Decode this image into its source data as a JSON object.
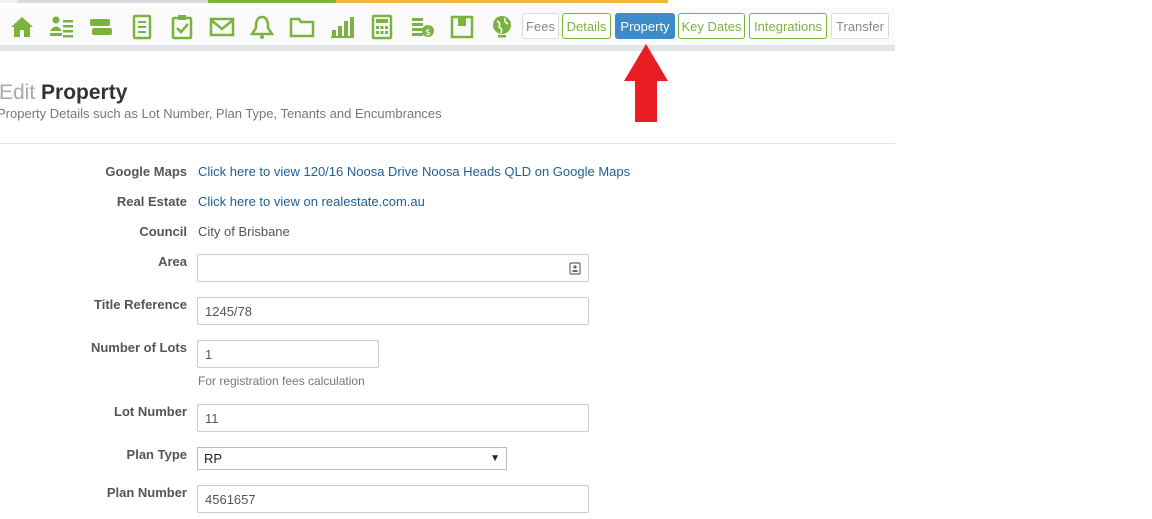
{
  "toolbar": {
    "icons": [
      "home-icon",
      "contacts-list-icon",
      "tag-label-icon",
      "document-icon",
      "checklist-icon",
      "envelope-icon",
      "bell-icon",
      "folder-icon",
      "bar-chart-icon",
      "calculator-icon",
      "money-coins-icon",
      "archive-box-icon",
      "globe-icon"
    ],
    "tabs": {
      "fees": "Fees",
      "details": "Details",
      "property": "Property",
      "key_dates": "Key Dates",
      "integrations": "Integrations",
      "transfer": "Transfer"
    },
    "colors": {
      "icon_green": "#7bb341",
      "active_tab": "#3c8ccc",
      "annotation_arrow": "#ea1c24"
    }
  },
  "header": {
    "title_prefix": "Edit",
    "title_main": "Property",
    "subtitle": "Property Details such as Lot Number, Plan Type, Tenants and Encumbrances"
  },
  "form": {
    "google_maps": {
      "label": "Google Maps",
      "link": "Click here to view 120/16 Noosa Drive Noosa Heads QLD on Google Maps"
    },
    "real_estate": {
      "label": "Real Estate",
      "link": "Click here to view on realestate.com.au"
    },
    "council": {
      "label": "Council",
      "value": "City of Brisbane"
    },
    "area": {
      "label": "Area",
      "value": ""
    },
    "title_reference": {
      "label": "Title Reference",
      "value": "1245/78"
    },
    "number_of_lots": {
      "label": "Number of Lots",
      "value": "1",
      "help": "For registration fees calculation"
    },
    "lot_number": {
      "label": "Lot Number",
      "value": "11"
    },
    "plan_type": {
      "label": "Plan Type",
      "value": "RP"
    },
    "plan_number": {
      "label": "Plan Number",
      "value": "4561657"
    }
  }
}
